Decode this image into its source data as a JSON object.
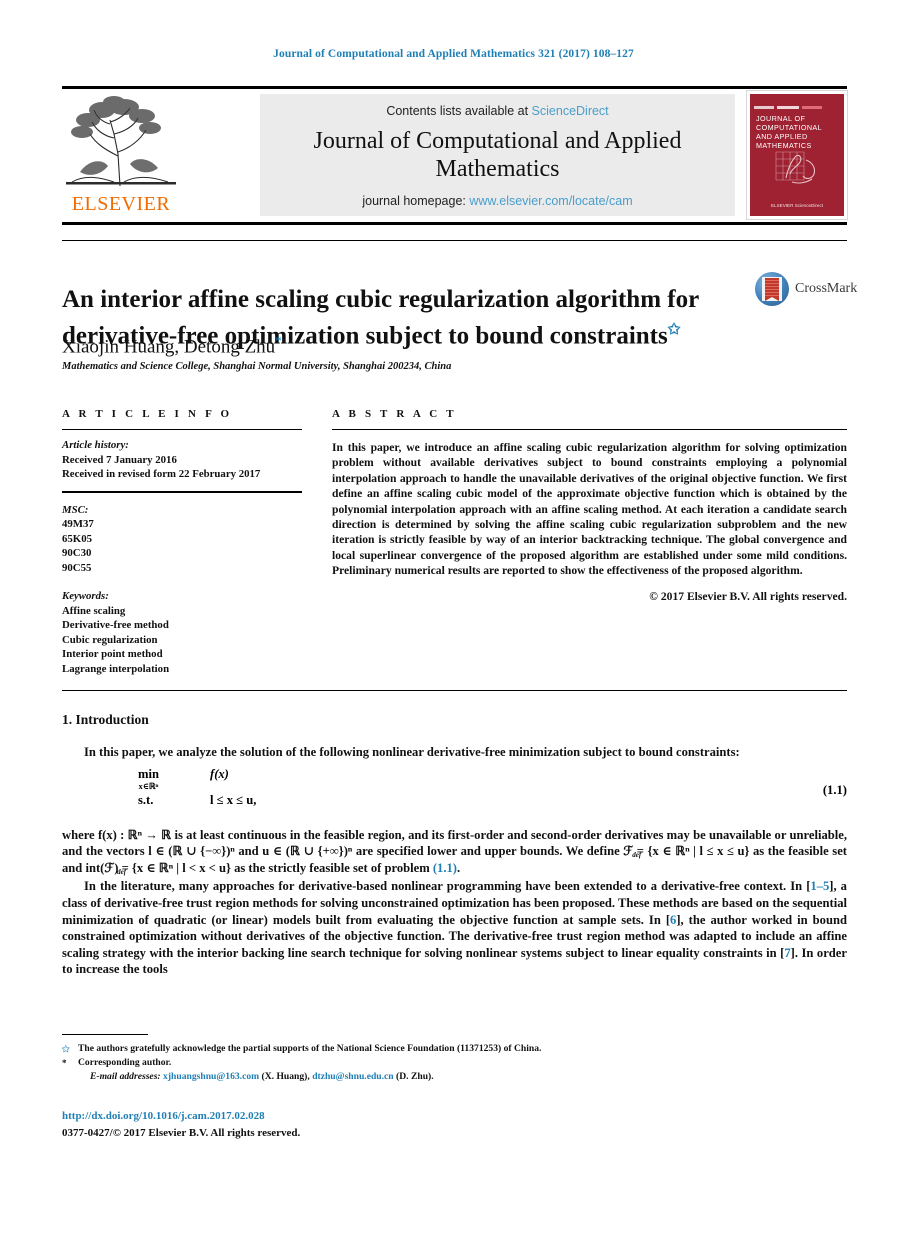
{
  "running_head": "Journal of Computational and Applied Mathematics 321 (2017) 108–127",
  "masthead": {
    "contents_prefix": "Contents lists available at",
    "contents_link": "ScienceDirect",
    "journal_title": "Journal of Computational and Applied Mathematics",
    "homepage_prefix": "journal homepage:",
    "homepage_link": "www.elsevier.com/locate/cam",
    "publisher": "ELSEVIER",
    "cover": {
      "title": "JOURNAL OF COMPUTATIONAL AND APPLIED MATHEMATICS",
      "footer": "ELSEVIER ScienceDirect"
    }
  },
  "article": {
    "title": "An interior affine scaling cubic regularization algorithm for derivative-free optimization subject to bound constraints",
    "title_footnote_mark": "✩",
    "authors": "Xiaojin Huang, Detong Zhu",
    "corresponding_mark": "*",
    "affiliation": "Mathematics and Science College, Shanghai Normal University, Shanghai 200234, China",
    "crossmark_label": "CrossMark"
  },
  "info": {
    "heading": "A R T I C L E   I N F O",
    "history_label": "Article history:",
    "history": [
      "Received 7 January 2016",
      "Received in revised form 22 February 2017"
    ],
    "msc_label": "MSC:",
    "msc": [
      "49M37",
      "65K05",
      "90C30",
      "90C55"
    ],
    "keywords_label": "Keywords:",
    "keywords": [
      "Affine scaling",
      "Derivative-free method",
      "Cubic regularization",
      "Interior point method",
      "Lagrange interpolation"
    ]
  },
  "abstract": {
    "heading": "A B S T R A C T",
    "text": "In this paper, we introduce an affine scaling cubic regularization algorithm for solving optimization problem without available derivatives subject to bound constraints employing a polynomial interpolation approach to handle the unavailable derivatives of the original objective function. We first define an affine scaling cubic model of the approximate objective function which is obtained by the polynomial interpolation approach with an affine scaling method. At each iteration a candidate search direction is determined by solving the affine scaling cubic regularization subproblem and the new iteration is strictly feasible by way of an interior backtracking technique. The global convergence and local superlinear convergence of the proposed algorithm are established under some mild conditions. Preliminary numerical results are reported to show the effectiveness of the proposed algorithm.",
    "copyright": "© 2017 Elsevier B.V. All rights reserved."
  },
  "body": {
    "section_heading": "1. Introduction",
    "para1": "In this paper, we analyze the solution of the following nonlinear derivative-free minimization subject to bound constraints:",
    "equation": {
      "min": "min",
      "min_sub": "x∈ℝⁿ",
      "objective": "f(x)",
      "st": "s.t.",
      "constraint": "l ≤ x ≤ u,",
      "number": "(1.1)"
    },
    "para2_a": "where ",
    "para2_b": "f(x) : ℝⁿ → ℝ is at least continuous in the feasible region, and its first-order and second-order derivatives may be unavailable or unreliable, and the vectors l ∈ (ℝ ∪ {−∞})ⁿ and u ∈ (ℝ ∪ {+∞})ⁿ are specified lower and upper bounds. We define ℱ ",
    "para2_def1": "def",
    "para2_c": "= {x ∈ ℝⁿ | l ≤ x ≤ u} as the feasible set and int(ℱ) ",
    "para2_def2": "def",
    "para2_d": "= {x ∈ ℝⁿ | l < x < u} as the strictly feasible set of problem ",
    "para2_ref": "(1.1)",
    "para2_e": ".",
    "para3_a": "In the literature, many approaches for derivative-based nonlinear programming have been extended to a derivative-free context. In [",
    "para3_ref1": "1–5",
    "para3_b": "], a class of derivative-free trust region methods for solving unconstrained optimization has been proposed. These methods are based on the sequential minimization of quadratic (or linear) models built from evaluating the objective function at sample sets. In [",
    "para3_ref2": "6",
    "para3_c": "], the author worked in bound constrained optimization without derivatives of the objective function. The derivative-free trust region method was adapted to include an affine scaling strategy with the interior backing line search technique for solving nonlinear systems subject to linear equality constraints in [",
    "para3_ref3": "7",
    "para3_d": "]. In order to increase the tools"
  },
  "footnotes": {
    "star_mark": "✩",
    "star_text": "The authors gratefully acknowledge the partial supports of the National Science Foundation (11371253) of China.",
    "corr_mark": "*",
    "corr_text": "Corresponding author.",
    "email_label": "E-mail addresses:",
    "email1": "xjhuangshnu@163.com",
    "email1_who": "(X. Huang),",
    "email2": "dtzhu@shnu.edu.cn",
    "email2_who": "(D. Zhu)."
  },
  "footer": {
    "doi": "http://dx.doi.org/10.1016/j.cam.2017.02.028",
    "issn": "0377-0427/© 2017 Elsevier B.V. All rights reserved."
  },
  "colors": {
    "link_blue": "#1f7fb5",
    "elsevier_orange": "#f06c00",
    "cover_red": "#9e2232"
  }
}
